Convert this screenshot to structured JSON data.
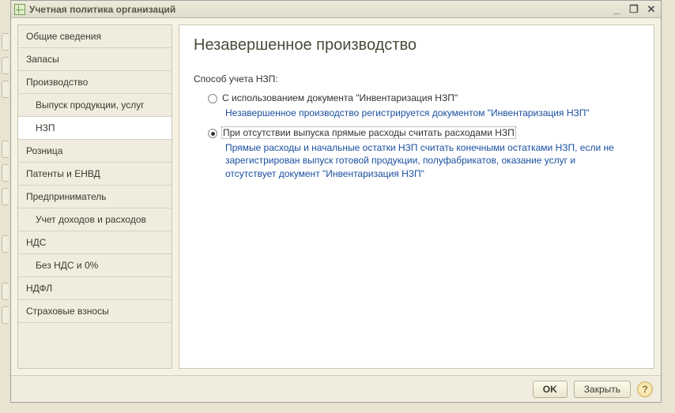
{
  "window": {
    "title": "Учетная политика организаций"
  },
  "sidebar": {
    "items": [
      {
        "label": "Общие сведения",
        "sub": false,
        "active": false
      },
      {
        "label": "Запасы",
        "sub": false,
        "active": false
      },
      {
        "label": "Производство",
        "sub": false,
        "active": false
      },
      {
        "label": "Выпуск продукции, услуг",
        "sub": true,
        "active": false
      },
      {
        "label": "НЗП",
        "sub": true,
        "active": true
      },
      {
        "label": "Розница",
        "sub": false,
        "active": false
      },
      {
        "label": "Патенты и ЕНВД",
        "sub": false,
        "active": false
      },
      {
        "label": "Предприниматель",
        "sub": false,
        "active": false
      },
      {
        "label": "Учет доходов и расходов",
        "sub": true,
        "active": false
      },
      {
        "label": "НДС",
        "sub": false,
        "active": false
      },
      {
        "label": "Без НДС и 0%",
        "sub": true,
        "active": false
      },
      {
        "label": "НДФЛ",
        "sub": false,
        "active": false
      },
      {
        "label": "Страховые взносы",
        "sub": false,
        "active": false
      }
    ]
  },
  "content": {
    "title": "Незавершенное производство",
    "section_label": "Способ учета НЗП:",
    "options": [
      {
        "label": "С использованием документа \"Инвентаризация НЗП\"",
        "desc": "Незавершенное производство регистрируется документом \"Инвентаризация НЗП\"",
        "checked": false
      },
      {
        "label": "При отсутствии выпуска прямые расходы считать расходами НЗП",
        "desc": "Прямые расходы и начальные остатки НЗП считать конечными остатками НЗП, если не зарегистрирован выпуск готовой продукции, полуфабрикатов, оказание услуг и отсутствует документ \"Инвентаризация НЗП\"",
        "checked": true
      }
    ]
  },
  "footer": {
    "ok": "OK",
    "close": "Закрыть",
    "help": "?"
  }
}
